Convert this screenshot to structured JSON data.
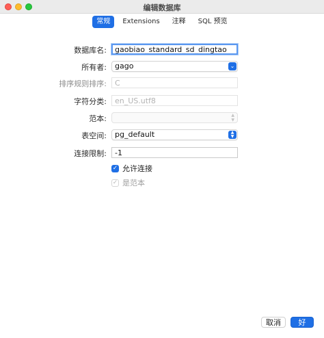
{
  "window": {
    "title": "编辑数据库"
  },
  "tabs": [
    {
      "label": "常规"
    },
    {
      "label": "Extensions"
    },
    {
      "label": "注释"
    },
    {
      "label": "SQL 预览"
    }
  ],
  "form": {
    "db_name": {
      "label": "数据库名:",
      "value": "gaobiao_standard_sd_dingtao"
    },
    "owner": {
      "label": "所有者:",
      "value": "gago"
    },
    "collation": {
      "label": "排序规则排序:",
      "value": "C"
    },
    "ctype": {
      "label": "字符分类:",
      "value": "en_US.utf8"
    },
    "template": {
      "label": "范本:",
      "value": ""
    },
    "tablespace": {
      "label": "表空间:",
      "value": "pg_default"
    },
    "conn_limit": {
      "label": "连接限制:",
      "value": "-1"
    },
    "allow_conn": {
      "label": "允许连接",
      "checked": true
    },
    "is_template": {
      "label": "是范本",
      "checked": true
    }
  },
  "footer": {
    "cancel_label": "取消",
    "ok_label": "好"
  },
  "colors": {
    "accent": "#1f6fe5",
    "focus": "#5b98f0"
  }
}
